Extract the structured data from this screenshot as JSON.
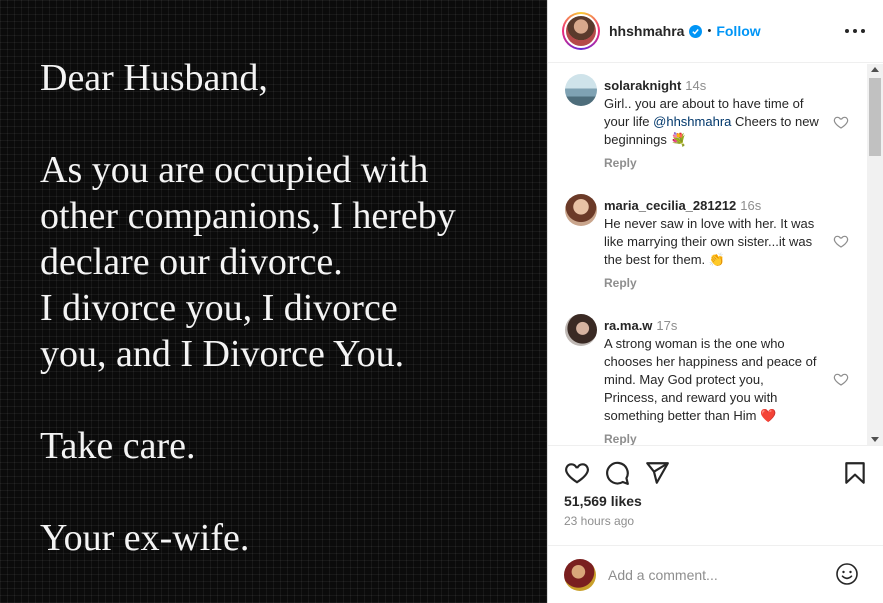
{
  "post": {
    "paragraphs": [
      "Dear Husband,",
      "As you are occupied with\nother companions, I hereby\ndeclare our divorce.\nI divorce you, I divorce\nyou, and I Divorce You.",
      "Take care.",
      "Your ex-wife."
    ]
  },
  "header": {
    "username": "hhshmahra",
    "separator": "•",
    "follow_label": "Follow"
  },
  "comments": [
    {
      "user": "solaraknight",
      "time": "14s",
      "text_before": "Girl.. you are about to have time of your life ",
      "mention": "@hhshmahra",
      "text_after": " Cheers to new beginnings 💐",
      "reply_label": "Reply"
    },
    {
      "user": "maria_cecilia_281212",
      "time": "16s",
      "text": "He never saw in love with her. It was like marrying their own sister...it was the best for them. 👏",
      "reply_label": "Reply"
    },
    {
      "user": "ra.ma.w",
      "time": "17s",
      "text": "A strong woman is the one who chooses her happiness and peace of mind. May God protect you, Princess, and reward you with something better than Him ❤️",
      "reply_label": "Reply"
    }
  ],
  "actions": {
    "icons": [
      "heart-icon",
      "comment-icon",
      "share-icon",
      "bookmark-icon"
    ],
    "likes": "51,569 likes",
    "time_ago": "23 hours ago"
  },
  "add_comment": {
    "placeholder": "Add a comment..."
  },
  "colors": {
    "accent": "#0095f6",
    "mention": "#00376b",
    "muted": "#8e8e8e",
    "heart_red": "#ed4956"
  }
}
